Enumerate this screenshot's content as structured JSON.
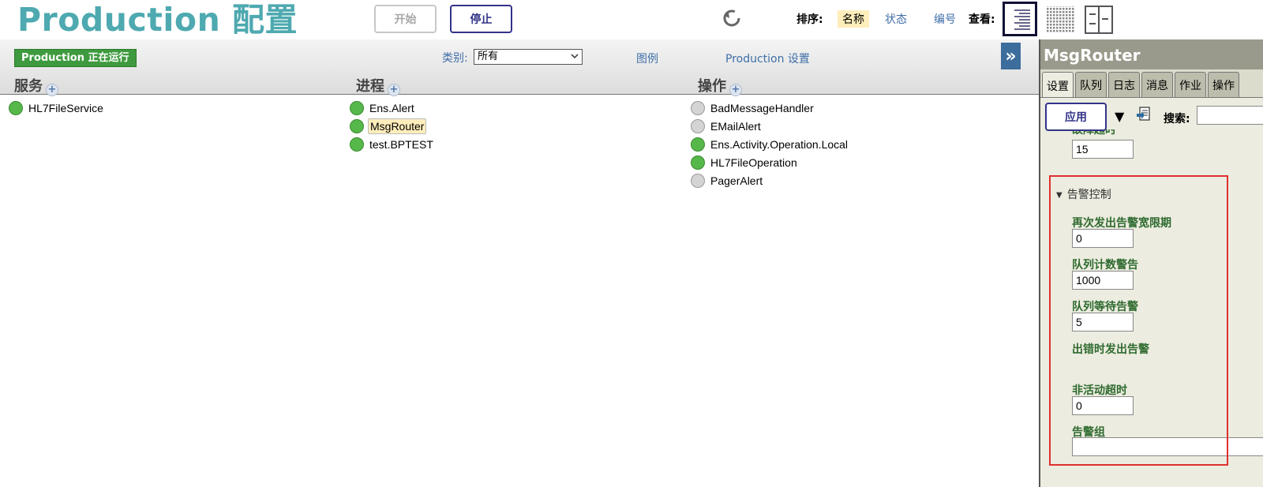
{
  "header": {
    "title": "Production 配置",
    "start_label": "开始",
    "stop_label": "停止",
    "sort_label": "排序:",
    "sort_options": [
      "名称",
      "状态",
      "编号"
    ],
    "view_label": "查看:"
  },
  "toolbar": {
    "status_badge": "Production 正在运行",
    "category_label": "类别:",
    "category_value": "所有",
    "legend_link": "图例",
    "production_settings_link": "Production 设置",
    "expand_glyph": "»"
  },
  "columns": {
    "services": {
      "title": "服务",
      "items": [
        {
          "name": "HL7FileService",
          "status": "green"
        }
      ]
    },
    "processes": {
      "title": "进程",
      "items": [
        {
          "name": "Ens.Alert",
          "status": "green"
        },
        {
          "name": "MsgRouter",
          "status": "green",
          "selected": true
        },
        {
          "name": "test.BPTEST",
          "status": "green"
        }
      ]
    },
    "operations": {
      "title": "操作",
      "items": [
        {
          "name": "BadMessageHandler",
          "status": "gray"
        },
        {
          "name": "EMailAlert",
          "status": "gray"
        },
        {
          "name": "Ens.Activity.Operation.Local",
          "status": "green"
        },
        {
          "name": "HL7FileOperation",
          "status": "green"
        },
        {
          "name": "PagerAlert",
          "status": "gray"
        }
      ]
    }
  },
  "panel": {
    "title": "MsgRouter",
    "tabs": [
      "设置",
      "队列",
      "日志",
      "消息",
      "作业",
      "操作"
    ],
    "active_tab": "设置",
    "apply_label": "应用",
    "search_label": "搜索:",
    "search_value": "",
    "cutoff_label": "故障超时",
    "cutoff_value": "15",
    "group_title": "告警控制",
    "fields": [
      {
        "label": "再次发出告警宽限期",
        "value": "0"
      },
      {
        "label": "队列计数警告",
        "value": "1000"
      },
      {
        "label": "队列等待告警",
        "value": "5"
      },
      {
        "label": "出错时发出告警",
        "value": false
      },
      {
        "label": "非活动超时",
        "value": "0"
      },
      {
        "label": "告警组",
        "value": ""
      }
    ]
  },
  "colors": {
    "title_teal": "#4ea9b0",
    "link_blue": "#3f6fa8",
    "running_green": "#3e9a3e",
    "highlight_yellow": "#ffeebb",
    "field_label_green": "#2e6a2e",
    "annotation_red": "#e03030"
  }
}
